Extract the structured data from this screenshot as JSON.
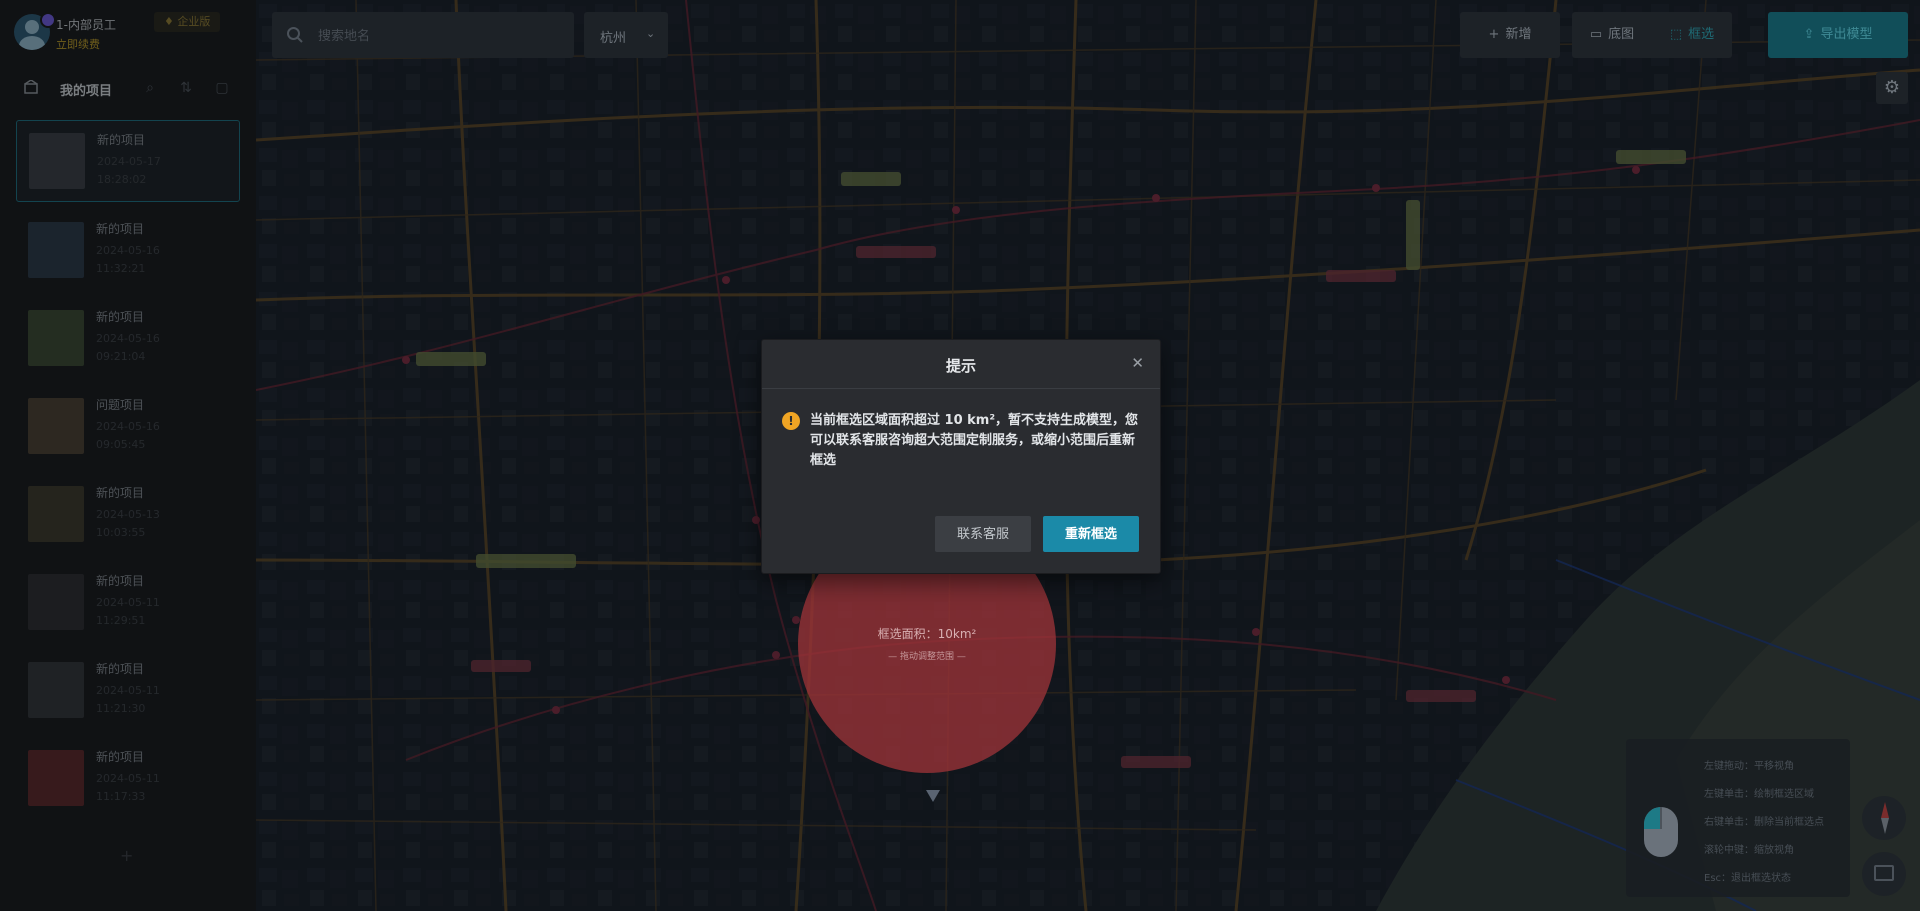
{
  "user": {
    "name": "1-内部员工",
    "subtitle": "立即续费",
    "vip_badge": "♦ 企业版"
  },
  "sidebar": {
    "title": "我的项目",
    "projects": [
      {
        "name": "新的项目",
        "date": "2024-05-17",
        "time": "18:28:02",
        "selected": true,
        "thumb_color": "#3a4048"
      },
      {
        "name": "新的项目",
        "date": "2024-05-16",
        "time": "11:32:21",
        "selected": false,
        "thumb_color": "#2c3a4a"
      },
      {
        "name": "新的项目",
        "date": "2024-05-16",
        "time": "09:21:04",
        "selected": false,
        "thumb_color": "#3b4a36"
      },
      {
        "name": "问题项目",
        "date": "2024-05-16",
        "time": "09:05:45",
        "selected": false,
        "thumb_color": "#4a4236"
      },
      {
        "name": "新的项目",
        "date": "2024-05-13",
        "time": "10:03:55",
        "selected": false,
        "thumb_color": "#3c3a30"
      },
      {
        "name": "新的项目",
        "date": "2024-05-11",
        "time": "11:29:51",
        "selected": false,
        "thumb_color": "#2e3034"
      },
      {
        "name": "新的项目",
        "date": "2024-05-11",
        "time": "11:21:30",
        "selected": false,
        "thumb_color": "#33383c"
      },
      {
        "name": "新的项目",
        "date": "2024-05-11",
        "time": "11:17:33",
        "selected": false,
        "thumb_color": "#5a2a2e"
      }
    ],
    "add_label": "+"
  },
  "toolbar": {
    "search_placeholder": "搜索地名",
    "city": "杭州",
    "add_label": "新增",
    "tab_layer": "底图",
    "tab_draw": "框选",
    "export_label": "导出模型"
  },
  "map": {
    "selection_label": "框选面积：10km²",
    "selection_sub": "— 拖动调整范围 —",
    "accent_red": "#a0343a"
  },
  "help": {
    "rows": [
      "左键拖动：平移视角",
      "左键单击：绘制框选区域",
      "右键单击：删除当前框选点",
      "滚轮中键：缩放视角",
      "Esc：退出框选状态"
    ]
  },
  "modal": {
    "title": "提示",
    "message": "当前框选区域面积超过 10 km²，暂不支持生成模型，您可以联系客服咨询超大范围定制服务，或缩小范围后重新框选",
    "contact_label": "联系客服",
    "reselect_label": "重新框选",
    "primary_color": "#1b8aa8",
    "warning_color": "#f0a524"
  }
}
